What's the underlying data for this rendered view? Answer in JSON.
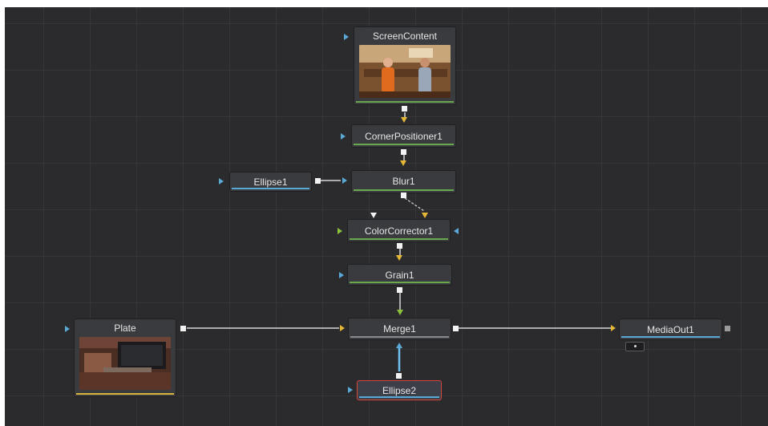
{
  "flow": {
    "nodes": {
      "screen_content": "ScreenContent",
      "corner_positioner": "CornerPositioner1",
      "blur": "Blur1",
      "ellipse1": "Ellipse1",
      "color_corrector": "ColorCorrector1",
      "grain": "Grain1",
      "plate": "Plate",
      "merge": "Merge1",
      "media_out": "MediaOut1",
      "ellipse2": "Ellipse2"
    },
    "selected_node": "Ellipse2",
    "colors": {
      "background": "#2b2b2d",
      "node": "#3a3b3f",
      "image_bar": "#6aa84f",
      "mask_bar": "#5aa8d6",
      "plate_bar": "#d7b33a",
      "selection": "#d8453a",
      "mask_wire": "#6ec0f0"
    }
  }
}
